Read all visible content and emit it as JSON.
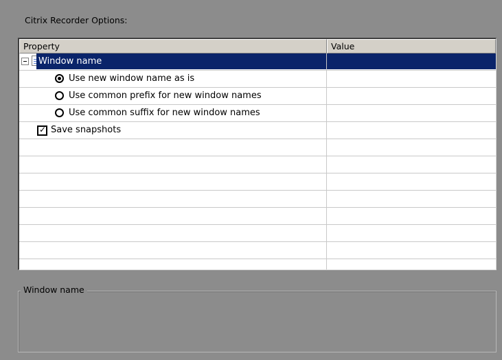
{
  "panel": {
    "title": "Citrix Recorder Options:"
  },
  "grid": {
    "columns": [
      "Property",
      "Value"
    ],
    "rows": [
      {
        "type": "group",
        "label": "Window name",
        "expanded": true,
        "selected": true,
        "value": ""
      },
      {
        "type": "radio",
        "label": "Use new window name as is",
        "checked": true,
        "value": ""
      },
      {
        "type": "radio",
        "label": "Use common prefix for new window names",
        "checked": false,
        "value": ""
      },
      {
        "type": "radio",
        "label": "Use common suffix for new window names",
        "checked": false,
        "value": ""
      },
      {
        "type": "checkbox",
        "label": "Save snapshots",
        "checked": true,
        "value": ""
      }
    ],
    "empty_row_count": 8
  },
  "description": {
    "legend": "Window name",
    "text": ""
  },
  "colors": {
    "background": "#8c8c8c",
    "selection": "#0a246a",
    "grid_background": "#ffffff",
    "header_background": "#d4d0c8"
  },
  "icons": {
    "expander": "minus-box-icon",
    "group": "document-icon",
    "radio": "radio-button-icon",
    "checkbox": "checkbox-icon"
  }
}
